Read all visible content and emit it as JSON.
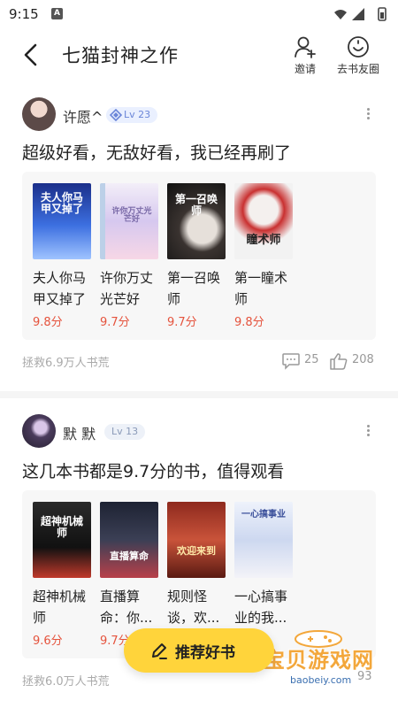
{
  "status": {
    "time": "9:15",
    "notif_letter": "A"
  },
  "header": {
    "title": "七猫封神之作",
    "invite_label": "邀请",
    "circle_label": "去书友圈"
  },
  "posts": [
    {
      "username": "许愿^",
      "level": "Lv 23",
      "text": "超级好看，无敌好看，我已经再刷了",
      "books": [
        {
          "name": "夫人你马甲又掉了",
          "score": "9.8分",
          "cover_text": "夫人你马甲又掉了"
        },
        {
          "name": "许你万丈光芒好",
          "score": "9.7分",
          "cover_text": "许你万丈光芒好"
        },
        {
          "name": "第一召唤师",
          "score": "9.7分",
          "cover_text": "第一召唤师"
        },
        {
          "name": "第一瞳术师",
          "score": "9.8分",
          "cover_text": "瞳术师"
        }
      ],
      "footer": "拯救6.9万人书荒",
      "comments": "25",
      "likes": "208"
    },
    {
      "username": "默 默",
      "level": "Lv 13",
      "text": "这几本书都是9.7分的书，值得观看",
      "books": [
        {
          "name": "超神机械师",
          "score": "9.6分",
          "cover_text": "超神机械师"
        },
        {
          "name": "直播算命：你...",
          "score": "9.7分",
          "cover_text": "直播算命"
        },
        {
          "name": "规则怪谈，欢...",
          "score": "",
          "cover_text": "欢迎来到"
        },
        {
          "name": "一心搞事业的我...",
          "score": "",
          "cover_text": "一心搞事业"
        }
      ],
      "footer": "拯救6.0万人书荒",
      "likes": "93"
    }
  ],
  "fab": {
    "label": "推荐好书"
  },
  "watermark": {
    "text": "宝贝游戏网",
    "url": "baobeiy.com"
  },
  "colors": {
    "score": "#e5533d",
    "fab": "#ffd43b",
    "level_badge": "#6b86d8"
  }
}
